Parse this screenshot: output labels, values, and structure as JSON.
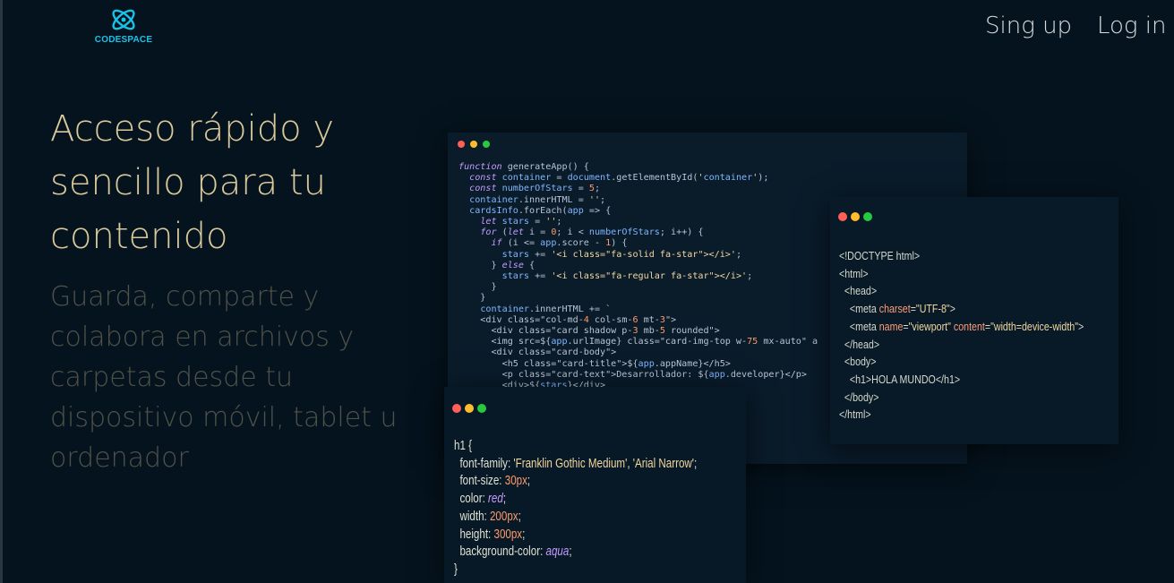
{
  "header": {
    "logo_text": "CODESPACE",
    "signup_label": "Sing up",
    "login_label": "Log in"
  },
  "hero": {
    "title": "Acceso rápido y sencillo para tu contenido",
    "subtitle": "Guarda, comparte y colabora en archivos y carpetas desde tu dispositivo móvil, tablet u ordenador"
  },
  "code_windows": {
    "js": {
      "lines": [
        "function generateApp() {",
        "  const container = document.getElementById('container');",
        "  const numberOfStars = 5;",
        "  container.innerHTML = '';",
        "  cardsInfo.forEach(app => {",
        "    let stars = '';",
        "    for (let i = 0; i < numberOfStars; i++) {",
        "      if (i <= app.score - 1) {",
        "        stars += '<i class=\"fa-solid fa-star\"></i>';",
        "      } else {",
        "        stars += '<i class=\"fa-regular fa-star\"></i>';",
        "      }",
        "    }",
        "    container.innerHTML += `",
        "    <div class=\"col-md-4 col-sm-6 mt-3\">",
        "      <div class=\"card shadow p-3 mb-5 rounded\">",
        "      <img src=${app.urlImage} class=\"card-img-top w-75 mx-auto\" a",
        "      <div class=\"card-body\">",
        "        <h5 class=\"card-title\">${app.appName}</h5>",
        "        <p class=\"card-text\">Desarrollador: ${app.developer}</p>",
        "        <div>${stars}</div>"
      ]
    },
    "html": {
      "lines": [
        "<!DOCTYPE html>",
        "<html>",
        "  <head>",
        "    <meta charset=\"UTF-8\">",
        "    <meta name=\"viewport\" content=\"width=device-width\">",
        "  </head>",
        "  <body>",
        "    <h1>HOLA MUNDO</h1>",
        "  </body>",
        "</html>"
      ]
    },
    "css": {
      "lines": [
        "h1 {",
        "  font-family: 'Franklin Gothic Medium', 'Arial Narrow';",
        "  font-size: 30px;",
        "  color: red;",
        "  width: 200px;",
        "  height: 300px;",
        "  background-color: aqua;",
        "}"
      ]
    }
  },
  "colors": {
    "background": "#05131e",
    "logo": "#19c3e8",
    "title": "#d8c89a",
    "subtitle": "#4f5249",
    "window_bg": "#0a1b2a",
    "dot_red": "#ff5f56",
    "dot_yellow": "#ffbd2e",
    "dot_green": "#27c93f"
  },
  "icons": {
    "logo": "atom-orbit-icon"
  }
}
